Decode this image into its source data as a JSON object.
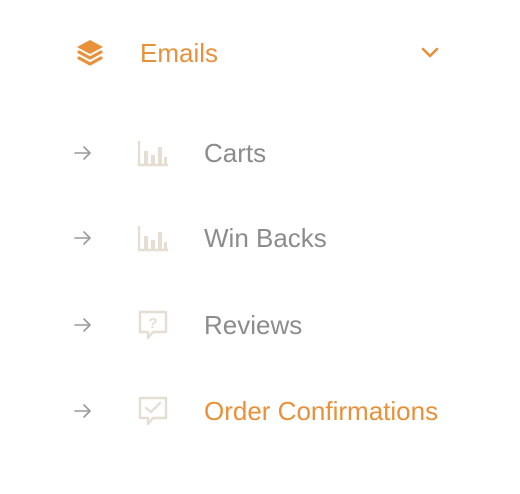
{
  "header": {
    "title": "Emails",
    "icon": "layers-icon",
    "toggle_icon": "chevron-down-icon",
    "accent_color": "#e8913a"
  },
  "items": [
    {
      "label": "Carts",
      "icon": "bar-chart-icon",
      "active": false
    },
    {
      "label": "Win Backs",
      "icon": "bar-chart-icon",
      "active": false
    },
    {
      "label": "Reviews",
      "icon": "question-comment-icon",
      "active": false
    },
    {
      "label": "Order Confirmations",
      "icon": "check-comment-icon",
      "active": true
    }
  ],
  "colors": {
    "accent": "#e8913a",
    "label": "#8c8c8c",
    "icon_muted": "#e6ded3",
    "arrow": "#9a9a9a"
  }
}
